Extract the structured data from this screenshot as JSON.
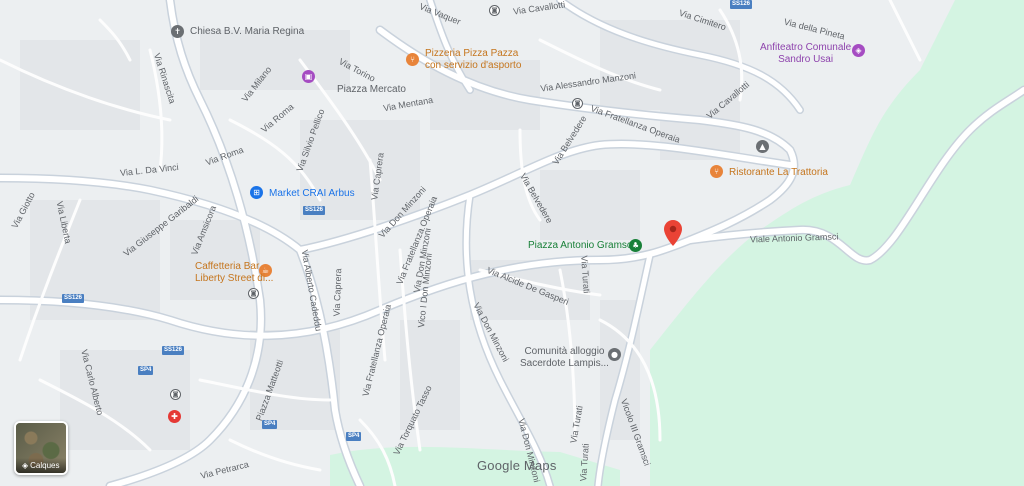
{
  "map": {
    "colors": {
      "land": "#eceff1",
      "park": "#d4f4e2",
      "road": "#ffffff",
      "road_casing": "#c9d2dc",
      "building": "#e4e7ea",
      "label": "#5f6368"
    },
    "layers_button": {
      "label": "Calques",
      "icon": "layers-icon"
    },
    "logo": "Google Maps",
    "selected_pin": {
      "icon": "red-pin-icon"
    },
    "street_labels": [
      "Via Vaquer",
      "Via Cavallotti",
      "Via Cimitero",
      "Via della Pineta",
      "Via Torino",
      "Via Milano",
      "Via Rinascita",
      "Via Roma",
      "Via Roma",
      "Via Mentana",
      "Via Alessandro Manzoni",
      "Via Cavallotti",
      "Via Fratellanza Operaia",
      "Via Belvedere",
      "Via Belvedere",
      "Via Silvio Pellico",
      "Via Caprera",
      "Via L. Da Vinci",
      "Via Giotto",
      "Via Liberta",
      "Via Giuseppe Garibaldi",
      "Via Amsicora",
      "Via Don Minzoni",
      "Via Fratellanza Operaia",
      "Via Don Minzoni",
      "Via Caprera",
      "Vico I Don Minzoni",
      "Via Alberto Cadeddu",
      "Via Alcide De Gasperi",
      "Via Turati",
      "Via Don Minzoni",
      "Viale Antonio Gramsci",
      "Via Fratellanza Operaia",
      "Piazza Matteotti",
      "Via Carlo Alberto",
      "Via Torquato Tasso",
      "Via Don Minzoni",
      "Via Turati",
      "Vicolo III Gramsci",
      "Via Petrarca",
      "Via Turati"
    ],
    "road_shields": [
      "SS126",
      "SS126",
      "SS126",
      "SS126",
      "SP4",
      "SP4",
      "SP4"
    ],
    "pois": [
      {
        "name": "Chiesa B.V. Maria Regina",
        "color": "#5f6368",
        "icon": "church-icon"
      },
      {
        "name": "Pizzeria Pizza Pazza\ncon servizio d'asporto",
        "color": "#c5751d",
        "icon": "restaurant-icon"
      },
      {
        "name": "Piazza Mercato",
        "color": "#5f6368",
        "icon": "shopping-icon"
      },
      {
        "name": "Anfiteatro Comunale\nSandro Usai",
        "color": "#8e44ad",
        "icon": "theater-icon"
      },
      {
        "name": "Ristorante La Trattoria",
        "color": "#c5751d",
        "icon": "restaurant-icon"
      },
      {
        "name": "Market CRAI Arbus",
        "color": "#1a73e8",
        "icon": "cart-icon"
      },
      {
        "name": "Piazza Antonio Gramsci",
        "color": "#188038",
        "icon": "park-icon"
      },
      {
        "name": "Caffetteria Bar\nLiberty Street di...",
        "color": "#c5751d",
        "icon": "cafe-icon"
      },
      {
        "name": "Comunità alloggio\nSacerdote Lampis...",
        "color": "#5f6368",
        "icon": "place-icon"
      }
    ]
  }
}
